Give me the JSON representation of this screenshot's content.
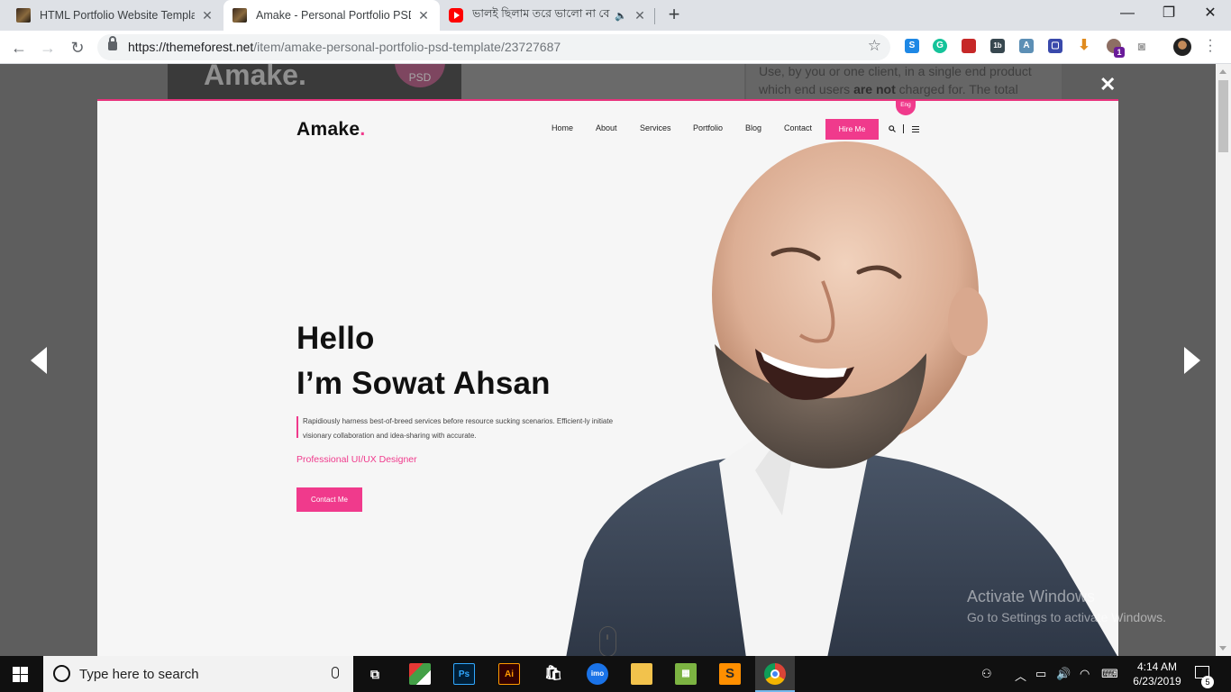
{
  "browser": {
    "tabs": [
      {
        "title": "HTML Portfolio Website Template",
        "active": false
      },
      {
        "title": "Amake - Personal Portfolio PSD T",
        "active": true
      },
      {
        "title": "ভালই ছিলাম তরে ভালো না বে",
        "active": false
      }
    ],
    "url_host": "https://themeforest.net",
    "url_path": "/item/amake-personal-portfolio-psd-template/23727687",
    "extension_badge": "1"
  },
  "background_page": {
    "logo": "Amake.",
    "badge": "PSD",
    "license_text_1": "Use, by you or one client, in a single end product which end users ",
    "license_bold": "are not",
    "license_text_2": " charged for. The total"
  },
  "hero": {
    "logo_text": "Amake",
    "logo_dot": ".",
    "nav": [
      "Home",
      "About",
      "Services",
      "Portfolio",
      "Blog",
      "Contact"
    ],
    "hire_button": "Hire Me",
    "language": "Eng",
    "greeting": "Hello",
    "headline": "I’m Sowat Ahsan",
    "description": "Rapidiously harness best-of-breed services before resource sucking scenarios. Efficient-ly initiate visionary collaboration and idea-sharing with accurate.",
    "role": "Professional UI/UX Designer",
    "cta": "Contact Me"
  },
  "watermark": {
    "line1": "Activate Windows",
    "line2": "Go to Settings to activate Windows."
  },
  "taskbar": {
    "search_placeholder": "Type here to search",
    "time": "4:14 AM",
    "date": "6/23/2019",
    "notifications": "5"
  },
  "colors": {
    "accent": "#f03a8c",
    "overlay": "#5e5e5e",
    "taskbar": "#101010"
  }
}
